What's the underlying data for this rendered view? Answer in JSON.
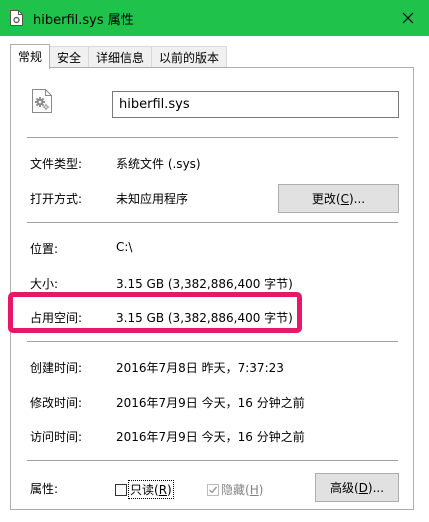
{
  "window": {
    "title": "hiberfil.sys 属性",
    "accent_color": "#1fc24a",
    "icons": {
      "title": "file-gear-icon",
      "close": "close-icon"
    }
  },
  "tabs": [
    {
      "label": "常规",
      "active": true
    },
    {
      "label": "安全",
      "active": false
    },
    {
      "label": "详细信息",
      "active": false
    },
    {
      "label": "以前的版本",
      "active": false
    }
  ],
  "general": {
    "filename": "hiberfil.sys",
    "file_type": {
      "label": "文件类型:",
      "value": "系统文件 (.sys)"
    },
    "opens_with": {
      "label": "打开方式:",
      "value": "未知应用程序"
    },
    "change_button": {
      "prefix": "更改(",
      "key": "C",
      "suffix": ")..."
    },
    "location": {
      "label": "位置:",
      "value": "C:\\"
    },
    "size": {
      "label": "大小:",
      "value": "3.15 GB (3,382,886,400 字节)"
    },
    "size_on_disk": {
      "label": "占用空间:",
      "value": "3.15 GB (3,382,886,400 字节)"
    },
    "created": {
      "label": "创建时间:",
      "value": "2016年7月8日 昨天，7:37:23"
    },
    "modified": {
      "label": "修改时间:",
      "value": "2016年7月9日 今天，16 分钟之前"
    },
    "accessed": {
      "label": "访问时间:",
      "value": "2016年7月9日 今天，16 分钟之前"
    },
    "attributes": {
      "label": "属性:",
      "readonly": {
        "prefix": "只读(",
        "key": "R",
        "suffix": ")",
        "checked": false
      },
      "hidden": {
        "prefix": "隐藏(",
        "key": "H",
        "suffix": ")",
        "checked": true,
        "disabled": true
      },
      "advanced_button": {
        "prefix": "高级(",
        "key": "D",
        "suffix": ")..."
      }
    }
  },
  "highlight_color": "#e5196a"
}
